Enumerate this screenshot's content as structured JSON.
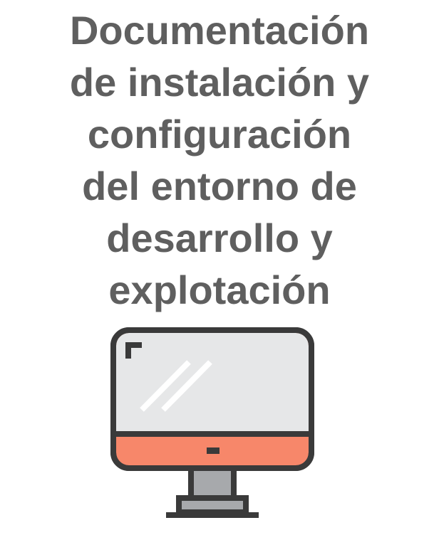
{
  "title_lines": [
    "Documentación",
    "de instalación y",
    "configuración",
    "del entorno de",
    "desarrollo y",
    "explotación"
  ],
  "icon": {
    "name": "desktop-monitor-icon",
    "colors": {
      "outline": "#3a3a3a",
      "screen": "#e6e7e8",
      "bezel": "#f7876a",
      "stand": "#a7a9ac",
      "reflection": "#ffffff"
    }
  }
}
